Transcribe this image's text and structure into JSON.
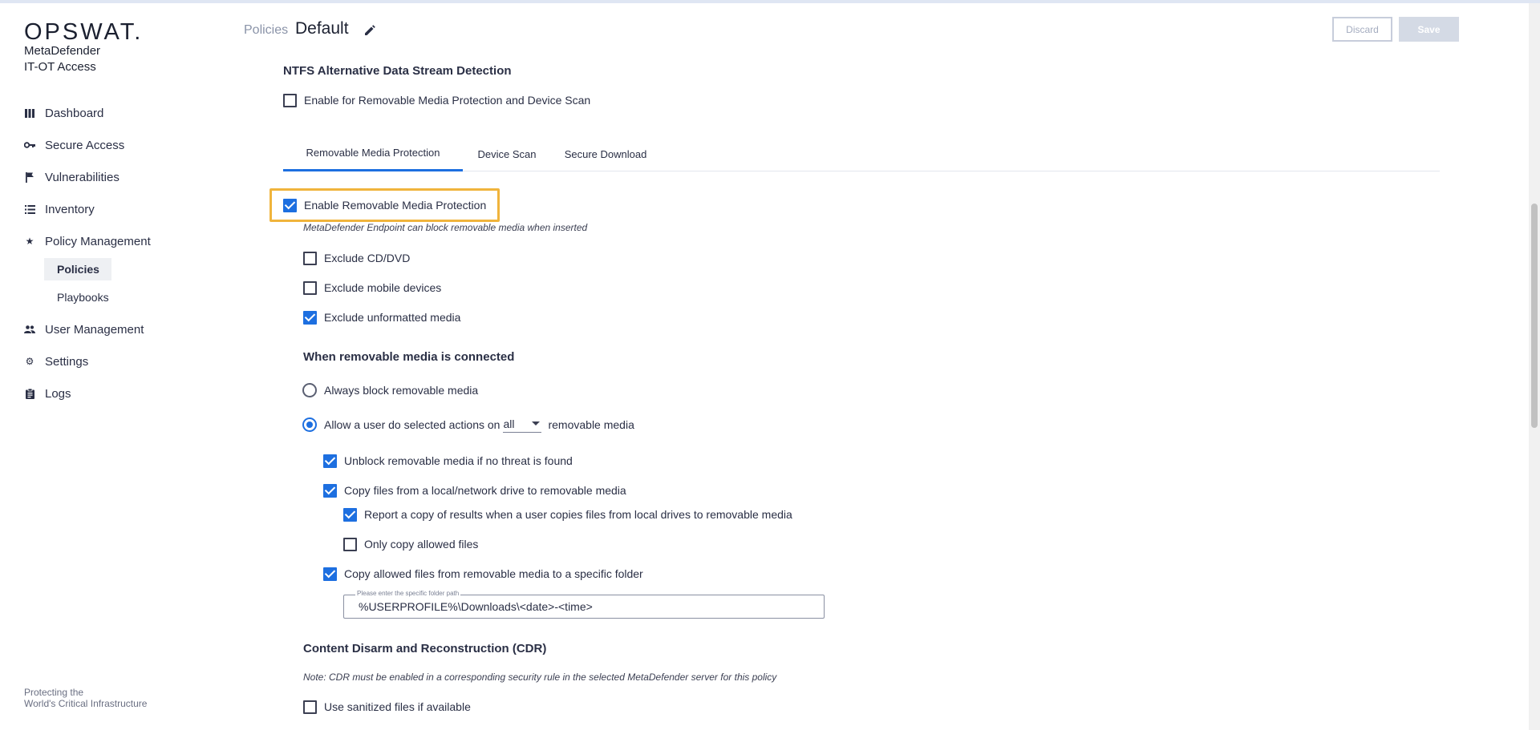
{
  "brand": {
    "logo": "OPSWAT.",
    "product_line1": "MetaDefender",
    "product_line2": "IT-OT Access",
    "tagline_line1": "Protecting the",
    "tagline_line2": "World's Critical Infrastructure"
  },
  "sidebar": {
    "items": [
      {
        "label": "Dashboard",
        "icon": "dashboard-icon"
      },
      {
        "label": "Secure Access",
        "icon": "key-icon"
      },
      {
        "label": "Vulnerabilities",
        "icon": "flag-icon"
      },
      {
        "label": "Inventory",
        "icon": "list-icon"
      },
      {
        "label": "Policy Management",
        "icon": "star-icon"
      },
      {
        "label": "User Management",
        "icon": "users-icon"
      },
      {
        "label": "Settings",
        "icon": "gear-icon"
      },
      {
        "label": "Logs",
        "icon": "clipboard-icon"
      }
    ],
    "sub_items": [
      {
        "label": "Policies",
        "active": true
      },
      {
        "label": "Playbooks",
        "active": false
      }
    ]
  },
  "header": {
    "breadcrumb": "Policies",
    "title": "Default",
    "discard_label": "Discard",
    "save_label": "Save"
  },
  "ntfs": {
    "title": "NTFS Alternative Data Stream Detection",
    "enable_label": "Enable for Removable Media Protection and Device Scan",
    "enable_checked": false
  },
  "tabs": [
    {
      "label": "Removable Media Protection",
      "active": true
    },
    {
      "label": "Device Scan",
      "active": false
    },
    {
      "label": "Secure Download",
      "active": false
    }
  ],
  "rmp": {
    "enable_label": "Enable Removable Media Protection",
    "enable_checked": true,
    "enable_hint": "MetaDefender Endpoint can block removable media when inserted",
    "exclude_cd_label": "Exclude CD/DVD",
    "exclude_cd_checked": false,
    "exclude_mobile_label": "Exclude mobile devices",
    "exclude_mobile_checked": false,
    "exclude_unformatted_label": "Exclude unformatted media",
    "exclude_unformatted_checked": true
  },
  "connected": {
    "title": "When removable media is connected",
    "always_block_label": "Always block removable media",
    "always_block_selected": false,
    "allow_label_prefix": "Allow a user do selected actions on",
    "allow_selected": true,
    "allow_scope_value": "all",
    "allow_label_suffix": "removable media",
    "unblock_label": "Unblock removable media if no threat is found",
    "unblock_checked": true,
    "copy_to_label": "Copy files from a local/network drive to removable media",
    "copy_to_checked": true,
    "report_label": "Report a copy of results when a user copies files from local drives to removable media",
    "report_checked": true,
    "only_allowed_label": "Only copy allowed files",
    "only_allowed_checked": false,
    "copy_from_label": "Copy allowed files from removable media to a specific folder",
    "copy_from_checked": true,
    "folder_placeholder": "Please enter the specific folder path",
    "folder_value": "%USERPROFILE%\\Downloads\\<date>-<time>"
  },
  "cdr": {
    "title": "Content Disarm and Reconstruction (CDR)",
    "note": "Note: CDR must be enabled in a corresponding security rule in the selected MetaDefender server for this policy",
    "sanitized_label": "Use sanitized files if available",
    "sanitized_checked": false
  },
  "colors": {
    "accent": "#1d6fe0",
    "highlight": "#f0b43c"
  }
}
